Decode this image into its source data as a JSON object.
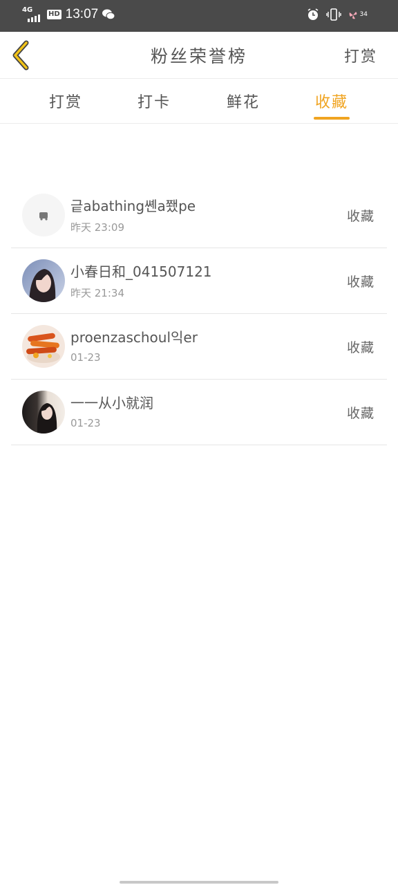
{
  "status_bar": {
    "network": "4G",
    "hd": "HD",
    "time": "13:07",
    "battery": "34",
    "icons": [
      "signal-icon",
      "wechat-icon",
      "alarm-icon",
      "vibrate-icon",
      "battery-icon"
    ]
  },
  "header": {
    "title": "粉丝荣誉榜",
    "action": "打赏"
  },
  "tabs": [
    {
      "label": "打赏",
      "active": false
    },
    {
      "label": "打卡",
      "active": false
    },
    {
      "label": "鲜花",
      "active": false
    },
    {
      "label": "收藏",
      "active": true
    }
  ],
  "colors": {
    "accent": "#f0a421",
    "status_bar": "#4a4a4a",
    "text": "#555555",
    "subtext": "#999999"
  },
  "list": [
    {
      "name": "긑abathing쏀a쬈pe",
      "time": "昨天 23:09",
      "action": "收藏",
      "avatar": "default-avatar"
    },
    {
      "name": "小春日和_041507121",
      "time": "昨天 21:34",
      "action": "收藏",
      "avatar": "girl-portrait-avatar"
    },
    {
      "name": "proenzaschoul익er",
      "time": "01-23",
      "action": "收藏",
      "avatar": "food-avatar"
    },
    {
      "name": "一一从小就润",
      "time": "01-23",
      "action": "收藏",
      "avatar": "girl-dark-hair-avatar"
    }
  ]
}
